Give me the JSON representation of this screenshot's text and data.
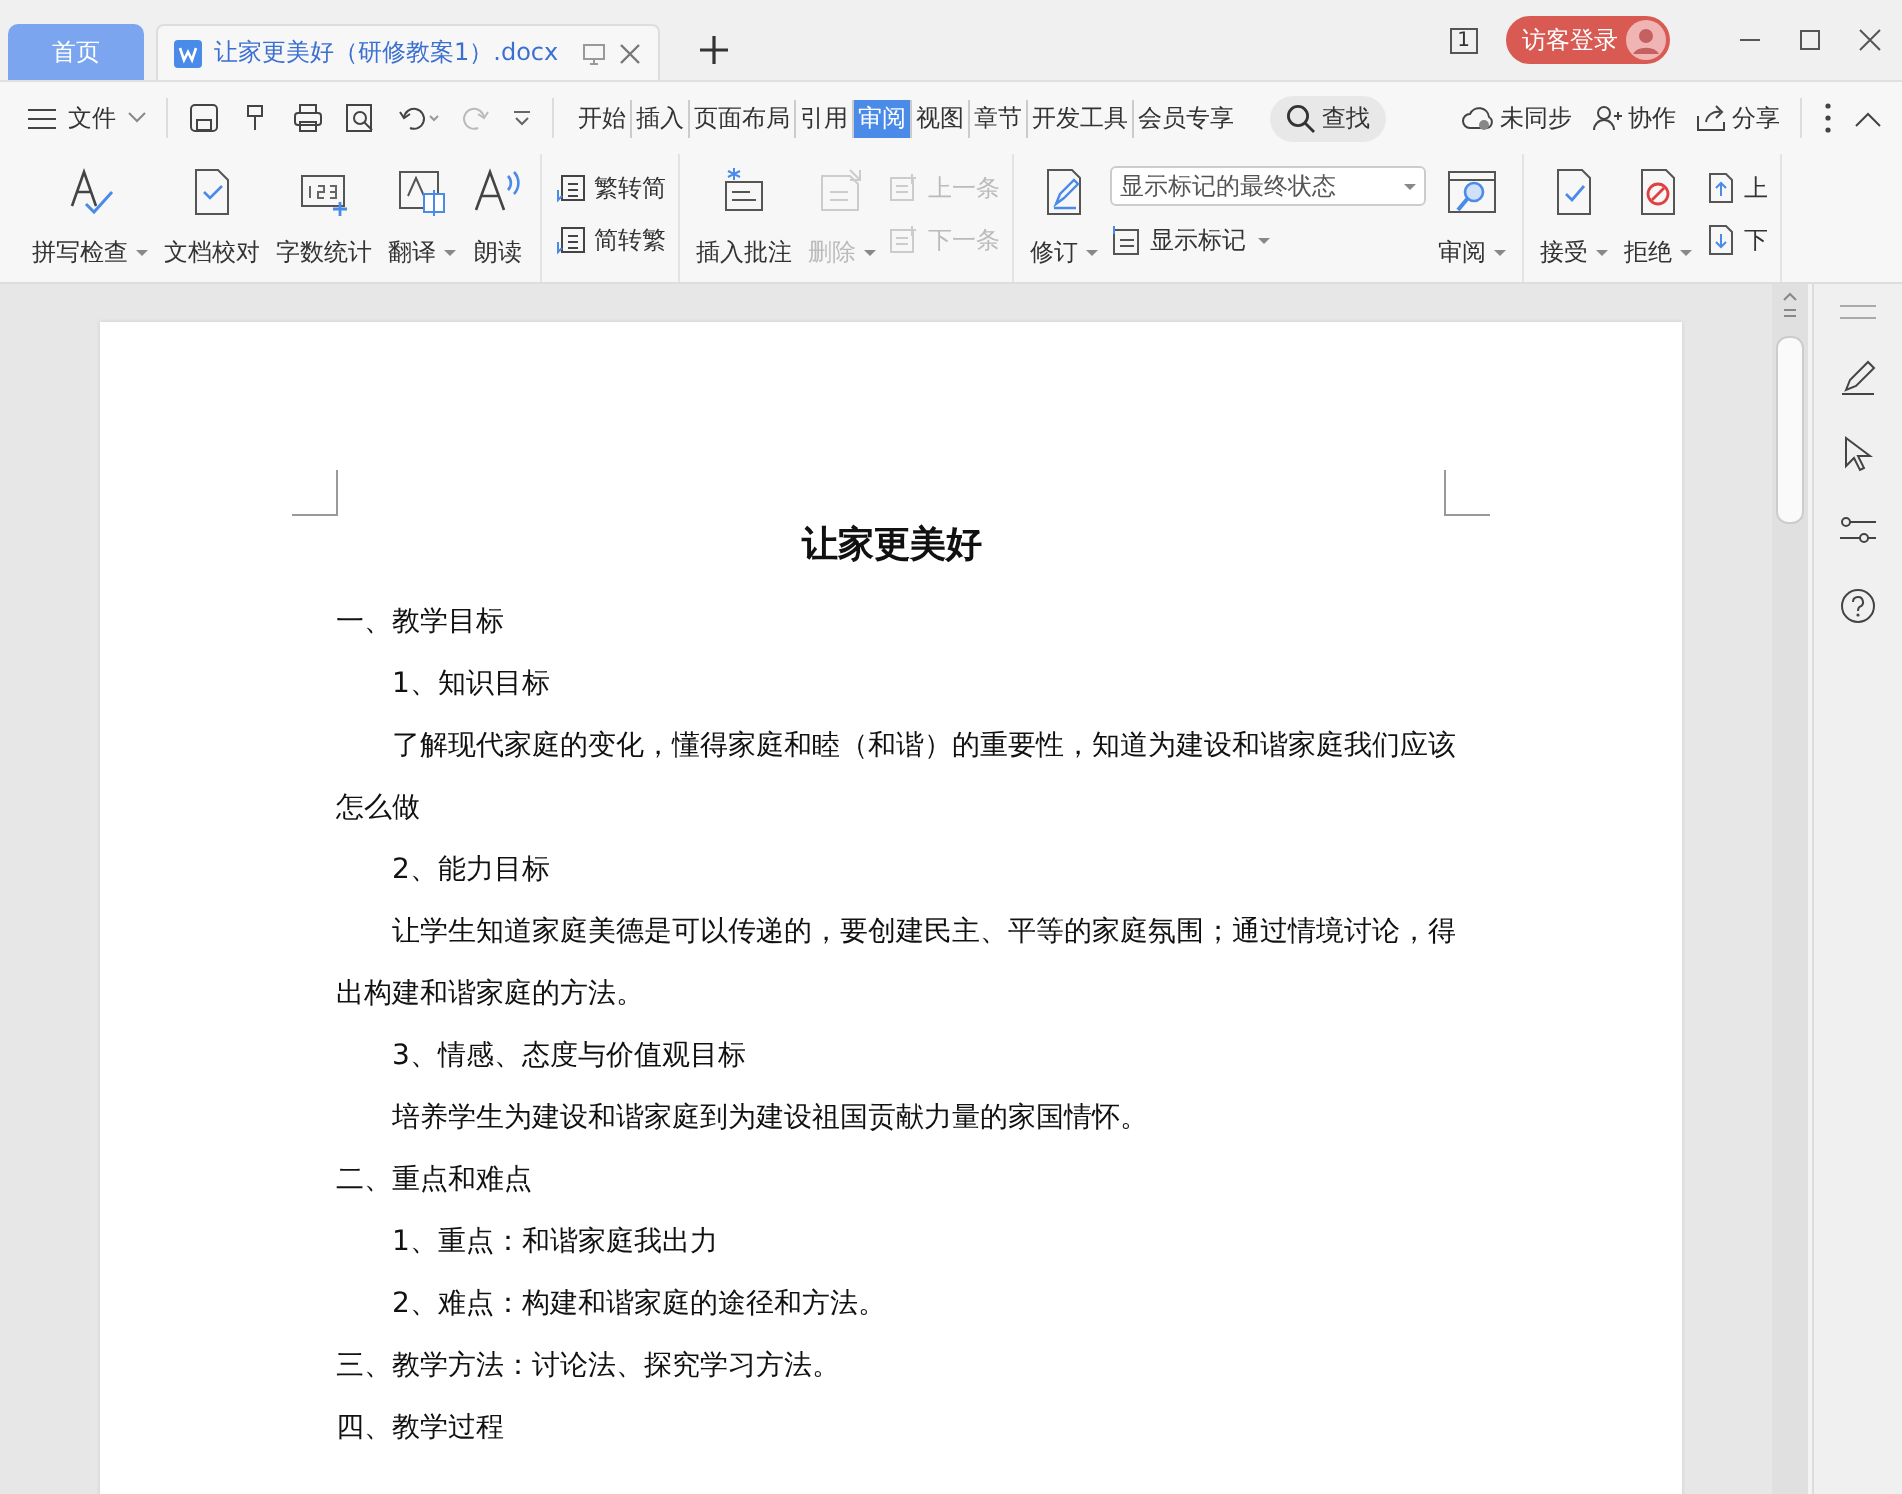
{
  "tabs": [
    {
      "label": "首页",
      "kind": "home",
      "selected": false
    },
    {
      "label": "让家更美好（研修教案1）.docx",
      "kind": "doc",
      "selected": true
    }
  ],
  "titlebar": {
    "page_count": "1",
    "login": "访客登录"
  },
  "menu": {
    "file": "文件",
    "tabs": [
      {
        "label": "开始",
        "selected": false
      },
      {
        "label": "插入",
        "selected": false
      },
      {
        "label": "页面布局",
        "selected": false
      },
      {
        "label": "引用",
        "selected": false
      },
      {
        "label": "审阅",
        "selected": true
      },
      {
        "label": "视图",
        "selected": false
      },
      {
        "label": "章节",
        "selected": false
      },
      {
        "label": "开发工具",
        "selected": false
      },
      {
        "label": "会员专享",
        "selected": false
      }
    ],
    "search": "查找",
    "actions": [
      "未同步",
      "协作",
      "分享"
    ]
  },
  "ribbon": [
    {
      "items": [
        {
          "kind": "large",
          "label": "拼写检查",
          "dropdown": true,
          "disabled": false
        },
        {
          "kind": "large",
          "label": "文档校对",
          "dropdown": false,
          "disabled": false
        },
        {
          "kind": "large",
          "label": "字数统计",
          "dropdown": false,
          "disabled": false
        },
        {
          "kind": "large",
          "label": "翻译",
          "dropdown": true,
          "disabled": false
        },
        {
          "kind": "large",
          "label": "朗读",
          "dropdown": false,
          "disabled": false
        }
      ]
    },
    {
      "items": [
        {
          "kind": "small",
          "label": "繁转简",
          "dropdown": false,
          "disabled": false
        },
        {
          "kind": "small",
          "label": "简转繁",
          "dropdown": false,
          "disabled": false
        }
      ]
    },
    {
      "items": [
        {
          "kind": "large",
          "label": "插入批注",
          "dropdown": false,
          "disabled": false
        },
        {
          "kind": "large",
          "label": "删除",
          "dropdown": true,
          "disabled": true
        },
        {
          "kind": "small",
          "label": "上一条",
          "dropdown": false,
          "disabled": true
        },
        {
          "kind": "small",
          "label": "下一条",
          "dropdown": false,
          "disabled": true
        }
      ]
    },
    {
      "items": [
        {
          "kind": "large",
          "label": "修订",
          "dropdown": true,
          "disabled": false
        },
        {
          "kind": "select",
          "label": "显示标记的最终状态",
          "dropdown": true,
          "disabled": false
        },
        {
          "kind": "small",
          "label": "显示标记",
          "dropdown": true,
          "disabled": false
        },
        {
          "kind": "large",
          "label": "审阅",
          "dropdown": true,
          "disabled": false
        }
      ]
    },
    {
      "items": [
        {
          "kind": "large",
          "label": "接受",
          "dropdown": true,
          "disabled": false
        },
        {
          "kind": "large",
          "label": "拒绝",
          "dropdown": true,
          "disabled": false
        },
        {
          "kind": "small",
          "label": "上",
          "dropdown": false,
          "disabled": false
        },
        {
          "kind": "small",
          "label": "下",
          "dropdown": false,
          "disabled": false
        }
      ]
    }
  ],
  "document": {
    "title": "让家更美好",
    "paragraphs": [
      {
        "text": "一、教学目标",
        "indent": false
      },
      {
        "text": "1、知识目标",
        "indent": true
      },
      {
        "text": "了解现代家庭的变化，懂得家庭和睦（和谐）的重要性，知道为建设和谐家庭我们应该怎么做",
        "indent": true
      },
      {
        "text": "2、能力目标",
        "indent": true
      },
      {
        "text": "让学生知道家庭美德是可以传递的，要创建民主、平等的家庭氛围；通过情境讨论，得出构建和谐家庭的方法。",
        "indent": true
      },
      {
        "text": "3、情感、态度与价值观目标",
        "indent": true
      },
      {
        "text": "培养学生为建设和谐家庭到为建设祖国贡献力量的家国情怀。",
        "indent": true
      },
      {
        "text": "二、重点和难点",
        "indent": false
      },
      {
        "text": "1、重点：和谐家庭我出力",
        "indent": true
      },
      {
        "text": "2、难点：构建和谐家庭的途径和方法。",
        "indent": true
      },
      {
        "text": "三、教学方法：讨论法、探究学习方法。",
        "indent": false
      },
      {
        "text": "四、教学过程",
        "indent": false
      }
    ]
  }
}
